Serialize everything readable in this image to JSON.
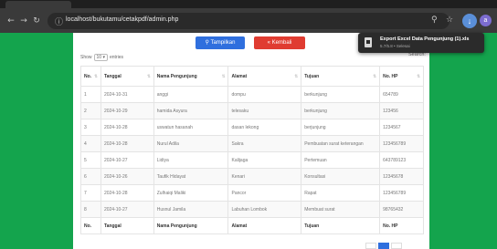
{
  "browser": {
    "url": "localhost/bukutamu/cetakpdf/admin.php",
    "icons": {
      "back": "arrow-left-icon",
      "forward": "arrow-right-icon",
      "reload": "reload-icon",
      "site_info": "site-info-icon",
      "zoom": "zoom-icon",
      "bookmark": "star-icon",
      "download": "download-icon",
      "profile": "profile-avatar"
    },
    "avatar_letter": "a"
  },
  "download": {
    "title": "Export Excel Data Pengunjung (1).xls",
    "subtitle": "5.7/5.8 • Selesai"
  },
  "page": {
    "buttons": {
      "tampilkan": "Tampilkan",
      "kembali": "Kembali"
    },
    "show_entries": {
      "prefix": "Show",
      "value": "10",
      "suffix": "entries"
    },
    "search_label": "Search:"
  },
  "table": {
    "headers": [
      "No.",
      "Tanggal",
      "Nama Pengunjung",
      "Alamat",
      "Tujuan",
      "No. HP"
    ],
    "rows": [
      [
        "1",
        "2024-10-31",
        "anggi",
        "dompu",
        "berkunjung",
        "654789"
      ],
      [
        "2",
        "2024-10-29",
        "hamida Asyura",
        "telesaku",
        "berkunjung",
        "123456"
      ],
      [
        "3",
        "2024-10-28",
        "uswatun hasanah",
        "dasan lekong",
        "berjunjung",
        "1234567"
      ],
      [
        "4",
        "2024-10-28",
        "Nurul Adila",
        "Sakra",
        "Pembuatan surat keterangan",
        "123456789"
      ],
      [
        "5",
        "2024-10-27",
        "Lidiya",
        "Kalijaga",
        "Pertemuan",
        "643789123"
      ],
      [
        "6",
        "2024-10-26",
        "Taufik Hidayat",
        "Kenari",
        "Konsultasi",
        "12345678"
      ],
      [
        "7",
        "2024-10-28",
        "Zulhaiqi Maliki",
        "Pancor",
        "Rapat",
        "123456789"
      ],
      [
        "8",
        "2024-10-27",
        "Husnul Jamila",
        "Labuhan Lombok",
        "Membuat surat",
        "98765432"
      ]
    ]
  },
  "colors": {
    "page_bg": "#14a44d",
    "btn_primary": "#2f6fde",
    "btn_danger": "#e03c31"
  }
}
